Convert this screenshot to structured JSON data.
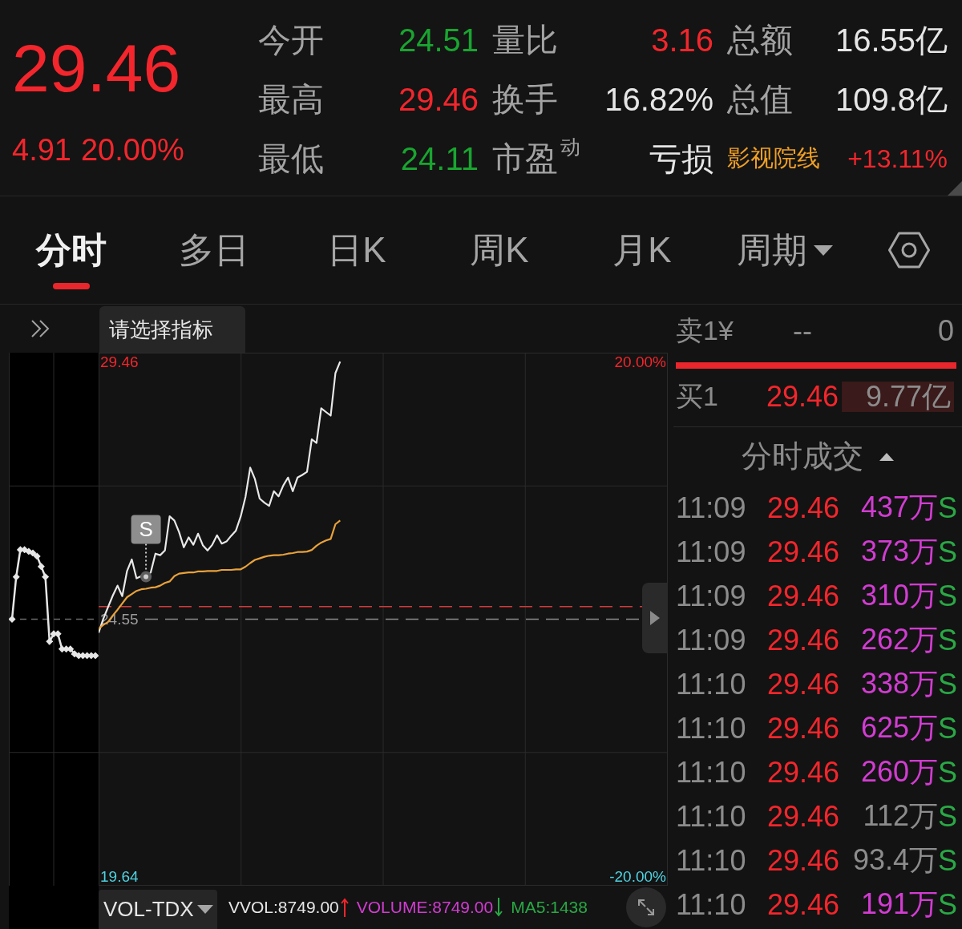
{
  "quote": {
    "price": "29.46",
    "change": "4.91",
    "change_pct": "20.00%",
    "color": "#f2262c"
  },
  "stats": [
    {
      "label": "今开",
      "value": "24.51",
      "color": "#19a530",
      "kind": "stat"
    },
    {
      "label": "量比",
      "value": "3.16",
      "color": "#f2262c",
      "kind": "stat"
    },
    {
      "label": "总额",
      "value": "16.55亿",
      "color": "#e6e6e6",
      "kind": "stat"
    },
    {
      "label": "最高",
      "value": "29.46",
      "color": "#f2262c",
      "kind": "stat"
    },
    {
      "label": "换手",
      "value": "16.82%",
      "color": "#e6e6e6",
      "kind": "stat"
    },
    {
      "label": "总值",
      "value": "109.8亿",
      "color": "#e6e6e6",
      "kind": "stat"
    },
    {
      "label": "最低",
      "value": "24.11",
      "color": "#19a530",
      "kind": "stat"
    },
    {
      "label": "市盈$^{动}$",
      "value": "亏损",
      "color": "#e6e6e6",
      "kind": "stat"
    },
    {
      "label": "影视院线",
      "value": "+13.11%",
      "color": "#f2262c",
      "kind": "sector"
    }
  ],
  "tabs": [
    {
      "label": "分时",
      "selected": true,
      "kind": "tab"
    },
    {
      "label": "多日",
      "selected": false,
      "kind": "tab"
    },
    {
      "label": "日K",
      "selected": false,
      "kind": "tab"
    },
    {
      "label": "周K",
      "selected": false,
      "kind": "tab"
    },
    {
      "label": "月K",
      "selected": false,
      "kind": "tab"
    },
    {
      "label": "周期",
      "selected": false,
      "kind": "dropdown"
    }
  ],
  "toolbar": {
    "indicator_picker": "请选择指标"
  },
  "chart": {
    "chart_data": {
      "type": "line",
      "categories": [
        null,
        null,
        null,
        null,
        null,
        null,
        null,
        null,
        null,
        null,
        null,
        null,
        null,
        null,
        null,
        null,
        null,
        null,
        null,
        null,
        null,
        null,
        null,
        null,
        null,
        null,
        null,
        null,
        null,
        null,
        null,
        null,
        null,
        null,
        null,
        null,
        null,
        null,
        null,
        null,
        null,
        null,
        null,
        null,
        null,
        null,
        null,
        null,
        null,
        null,
        null,
        null,
        null,
        null,
        null,
        null,
        null,
        null,
        null,
        null,
        null,
        null,
        null,
        null,
        null,
        null,
        null,
        null,
        null,
        null,
        null,
        null,
        null,
        null,
        null,
        null,
        null,
        null,
        null,
        null,
        null,
        null,
        null,
        null,
        null,
        null,
        null,
        null,
        null,
        null,
        null,
        null,
        null,
        null,
        null,
        null,
        null,
        null,
        null,
        null,
        null,
        null,
        null,
        null,
        null,
        null,
        null,
        null,
        null,
        null,
        null,
        null,
        null,
        null,
        null,
        null,
        null,
        null,
        null,
        null,
        null
      ],
      "ylim": [
        19.47,
        29.63
      ],
      "yticks": [
        29.46,
        24.55,
        19.64
      ],
      "series": [
        {
          "color": "#e8e8e8",
          "values": [
            24.29,
            24.56,
            24.78,
            25.0,
            25.19,
            24.99,
            25.47,
            25.69,
            25.33,
            25.37,
            25.36,
            25.44,
            25.8,
            25.77,
            25.86,
            26.51,
            26.43,
            26.21,
            25.92,
            26.11,
            25.97,
            26.18,
            25.96,
            25.86,
            25.97,
            26.15,
            25.99,
            26.03,
            26.14,
            26.24,
            26.51,
            26.88,
            27.44,
            27.22,
            26.85,
            26.77,
            26.71,
            26.99,
            26.89,
            27.1,
            27.25,
            26.99,
            27.25,
            27.3,
            27.36,
            27.98,
            27.91,
            28.57,
            28.5,
            28.43,
            29.24,
            29.46,
            null,
            null,
            null,
            null,
            null,
            null,
            null,
            null,
            null,
            null,
            null,
            null,
            null,
            null,
            null,
            null,
            null,
            null,
            null,
            null,
            null,
            null,
            null,
            null,
            null,
            null,
            null,
            null,
            null,
            null,
            null,
            null,
            null,
            null,
            null,
            null,
            null,
            null,
            null,
            null,
            null,
            null,
            null,
            null,
            null,
            null,
            null,
            null,
            null,
            null,
            null,
            null,
            null,
            null,
            null,
            null,
            null,
            null,
            null,
            null,
            null,
            null,
            null,
            null,
            null,
            null,
            null,
            null,
            null
          ]
        },
        {
          "color": "#e9a23b",
          "values": [
            24.37,
            24.44,
            24.5,
            24.62,
            24.73,
            24.85,
            24.97,
            25.03,
            25.09,
            25.12,
            25.13,
            25.15,
            25.16,
            25.19,
            25.24,
            25.27,
            25.37,
            25.42,
            25.43,
            25.44,
            25.44,
            25.46,
            25.46,
            25.47,
            25.47,
            25.47,
            25.49,
            25.49,
            25.49,
            25.5,
            25.5,
            25.55,
            25.62,
            25.68,
            25.71,
            25.74,
            25.76,
            25.77,
            25.77,
            25.78,
            25.8,
            25.81,
            25.83,
            25.83,
            25.84,
            25.87,
            25.95,
            26.01,
            26.05,
            26.08,
            26.36,
            26.43,
            null,
            null,
            null,
            null,
            null,
            null,
            null,
            null,
            null,
            null,
            null,
            null,
            null,
            null,
            null,
            null,
            null,
            null,
            null,
            null,
            null,
            null,
            null,
            null,
            null,
            null,
            null,
            null,
            null,
            null,
            null,
            null,
            null,
            null,
            null,
            null,
            null,
            null,
            null,
            null,
            null,
            null,
            null,
            null,
            null,
            null,
            null,
            null,
            null,
            null,
            null,
            null,
            null,
            null,
            null,
            null,
            null,
            null,
            null,
            null,
            null,
            null,
            null,
            null,
            null,
            null,
            null,
            null,
            null
          ]
        }
      ],
      "ref_lines": [
        {
          "axis": "y",
          "value": 24.79
        },
        {
          "axis": "y",
          "value": 24.55
        }
      ],
      "annotations": [
        {
          "text": "S"
        }
      ]
    },
    "right_labels": [
      {
        "label": "20.00%",
        "color": "#f2262c"
      },
      {
        "label": "-20.00%",
        "color": "#4fd2e0"
      }
    ]
  },
  "indicator_bar": {
    "selector": "VOL-TDX",
    "readings": [
      {
        "text": "VVOL:8749.00",
        "color": "#e6e6e6",
        "kind": "rising"
      },
      {
        "text": "VOLUME:8749.00",
        "color": "#d23cd2",
        "kind": "falling"
      },
      {
        "text": "MA5:1438",
        "color": "#2aa845",
        "kind": "plain"
      }
    ]
  },
  "order_book": {
    "sell": {
      "label": "卖1¥",
      "price": "--",
      "volume": "0"
    },
    "ratio_bar": {
      "level": 1
    },
    "buy": {
      "label": "买1",
      "price": "29.46",
      "volume": "9.77亿"
    }
  },
  "trades": {
    "title": "分时成交",
    "rows": [
      {
        "time": "11:09",
        "price": "29.46",
        "volume": "437万",
        "large": true,
        "side": "S"
      },
      {
        "time": "11:09",
        "price": "29.46",
        "volume": "373万",
        "large": true,
        "side": "S"
      },
      {
        "time": "11:09",
        "price": "29.46",
        "volume": "310万",
        "large": true,
        "side": "S"
      },
      {
        "time": "11:09",
        "price": "29.46",
        "volume": "262万",
        "large": true,
        "side": "S"
      },
      {
        "time": "11:10",
        "price": "29.46",
        "volume": "338万",
        "large": true,
        "side": "S"
      },
      {
        "time": "11:10",
        "price": "29.46",
        "volume": "625万",
        "large": true,
        "side": "S"
      },
      {
        "time": "11:10",
        "price": "29.46",
        "volume": "260万",
        "large": true,
        "side": "S"
      },
      {
        "time": "11:10",
        "price": "29.46",
        "volume": "112万",
        "large": false,
        "side": "S"
      },
      {
        "time": "11:10",
        "price": "29.46",
        "volume": "93.4万",
        "large": false,
        "side": "S"
      },
      {
        "time": "11:10",
        "price": "29.46",
        "volume": "191万",
        "large": true,
        "side": "S"
      }
    ]
  }
}
